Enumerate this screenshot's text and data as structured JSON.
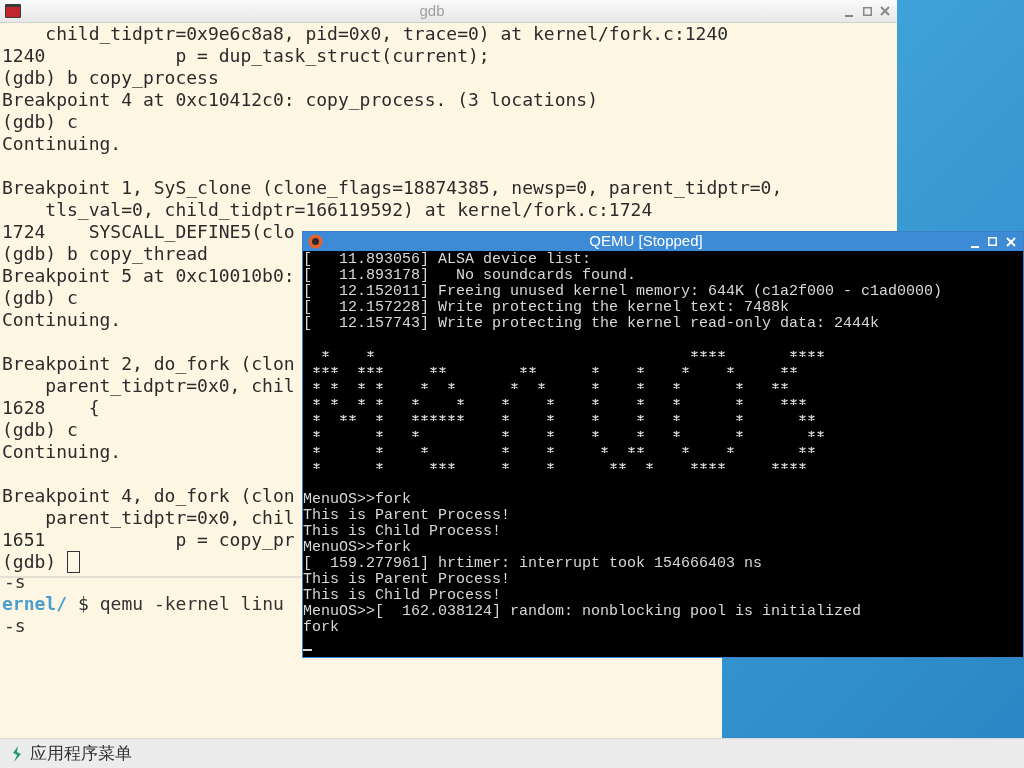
{
  "gdb_window": {
    "title": "gdb",
    "blocks": [
      [
        "    child_tidptr=0x9e6c8a8, pid=0x0, trace=0) at kernel/fork.c:1240",
        "1240            p = dup_task_struct(current);",
        "(gdb) b copy_process",
        "Breakpoint 4 at 0xc10412c0: copy_process. (3 locations)",
        "(gdb) c",
        "Continuing."
      ],
      [
        "Breakpoint 1, SyS_clone (clone_flags=18874385, newsp=0, parent_tidptr=0,",
        "    tls_val=0, child_tidptr=166119592) at kernel/fork.c:1724",
        "1724    SYSCALL_DEFINE5(clo",
        "(gdb) b copy_thread",
        "Breakpoint 5 at 0xc10010b0:",
        "(gdb) c",
        "Continuing."
      ],
      [
        "Breakpoint 2, do_fork (clon",
        "    parent_tidptr=0x0, chil",
        "1628    {",
        "(gdb) c",
        "Continuing."
      ],
      [
        "Breakpoint 4, do_fork (clon",
        "    parent_tidptr=0x0, chil",
        "1651            p = copy_pr"
      ]
    ],
    "prompt": "(gdb)"
  },
  "lower_terminal": {
    "lines": [
      {
        "kind": "output",
        "text": "-s"
      },
      {
        "kind": "prompt",
        "path": "ernel/",
        "command": "$ qemu -kernel linu"
      },
      {
        "kind": "output",
        "text": "-s"
      }
    ]
  },
  "qemu_window": {
    "title": "QEMU [Stopped]",
    "kernel_log": [
      "[   11.893056] ALSA device list:",
      "[   11.893178]   No soundcards found.",
      "[   12.152011] Freeing unused kernel memory: 644K (c1a2f000 - c1ad0000)",
      "[   12.157228] Write protecting the kernel text: 7488k",
      "[   12.157743] Write protecting the kernel read-only data: 2444k"
    ],
    "shell": [
      "MenuOS>>fork",
      "This is Parent Process!",
      "This is Child Process!",
      "MenuOS>>fork",
      "[  159.277961] hrtimer: interrupt took 154666403 ns",
      "This is Parent Process!",
      "This is Child Process!",
      "MenuOS>>[  162.038124] random: nonblocking pool is initialized",
      "fork"
    ]
  },
  "taskbar": {
    "menu_label": "应用程序菜单"
  }
}
